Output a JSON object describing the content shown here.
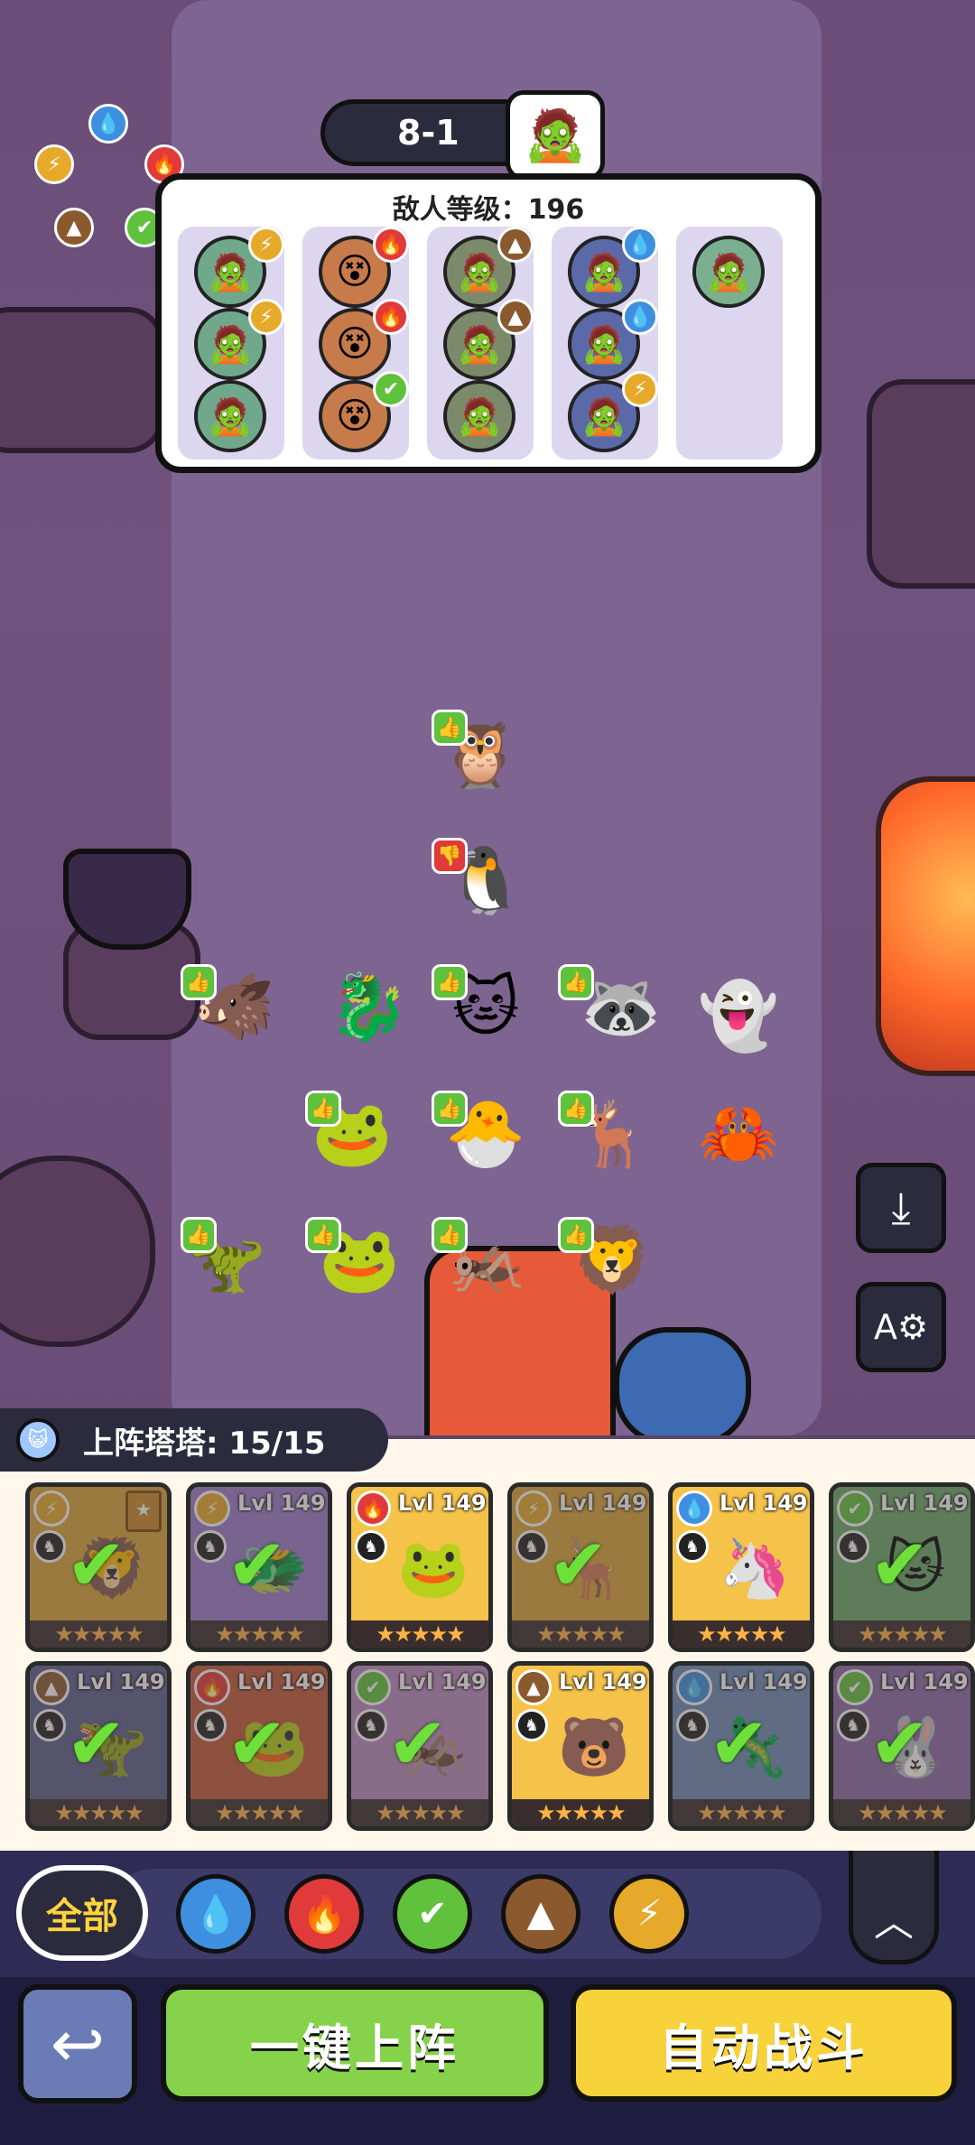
{
  "stage": {
    "label": "8-1",
    "boss_icon": "zombie-face-icon"
  },
  "enemy_panel": {
    "title": "敌人等级：196",
    "columns": [
      {
        "faces": [
          {
            "element": "lightning"
          },
          {
            "element": "lightning"
          },
          {
            "element": "none"
          }
        ]
      },
      {
        "faces": [
          {
            "element": "fire"
          },
          {
            "element": "fire"
          },
          {
            "element": "leaf"
          }
        ]
      },
      {
        "faces": [
          {
            "element": "earth"
          },
          {
            "element": "earth"
          },
          {
            "element": "none"
          }
        ]
      },
      {
        "faces": [
          {
            "element": "water"
          },
          {
            "element": "water"
          },
          {
            "element": "lightning"
          }
        ]
      },
      {
        "faces": [
          {
            "element": "none"
          }
        ]
      }
    ]
  },
  "element_wheel": [
    "water",
    "fire",
    "leaf",
    "earth",
    "lightning"
  ],
  "roster": {
    "title": "上阵塔塔: 15/15"
  },
  "cards": [
    {
      "lvl": "",
      "element": "lightning",
      "deployed": true,
      "color": "#d9a53a",
      "pic": "🦁",
      "locked_badge": true
    },
    {
      "lvl": "Lvl 149",
      "element": "lightning",
      "deployed": true,
      "color": "#9a7cc9",
      "pic": "🐲"
    },
    {
      "lvl": "Lvl 149",
      "element": "fire",
      "deployed": false,
      "color": "#f5c24a",
      "pic": "🐸"
    },
    {
      "lvl": "Lvl 149",
      "element": "lightning",
      "deployed": true,
      "color": "#d9a53a",
      "pic": "🦌"
    },
    {
      "lvl": "Lvl 149",
      "element": "water",
      "deployed": false,
      "color": "#f5c24a",
      "pic": "🦄"
    },
    {
      "lvl": "Lvl 149",
      "element": "leaf",
      "deployed": true,
      "color": "#6aa86a",
      "pic": "🐱"
    },
    {
      "lvl": "Lvl 149",
      "element": "earth",
      "deployed": true,
      "color": "#5b5d8a",
      "pic": "🦖"
    },
    {
      "lvl": "Lvl 149",
      "element": "fire",
      "deployed": true,
      "color": "#c25a3a",
      "pic": "🐸"
    },
    {
      "lvl": "Lvl 149",
      "element": "leaf",
      "deployed": true,
      "color": "#b98bbf",
      "pic": "🦗"
    },
    {
      "lvl": "Lvl 149",
      "element": "earth",
      "deployed": false,
      "color": "#f5c24a",
      "pic": "🐻"
    },
    {
      "lvl": "Lvl 149",
      "element": "water",
      "deployed": true,
      "color": "#6d8ab5",
      "pic": "🦎"
    },
    {
      "lvl": "Lvl 149",
      "element": "leaf",
      "deployed": true,
      "color": "#8a6aa8",
      "pic": "🐰"
    }
  ],
  "filters": {
    "all_label": "全部",
    "elements": [
      "water",
      "fire",
      "leaf",
      "earth",
      "lightning"
    ]
  },
  "buttons": {
    "auto_deploy": "一键上阵",
    "auto_battle": "自动战斗"
  },
  "colors": {
    "water": "#3f8fe0",
    "fire": "#e03a3a",
    "leaf": "#5fc13c",
    "earth": "#8a5a2e",
    "lightning": "#e6a92a",
    "green_button": "#86d24a",
    "yellow_button": "#f7d23a"
  }
}
